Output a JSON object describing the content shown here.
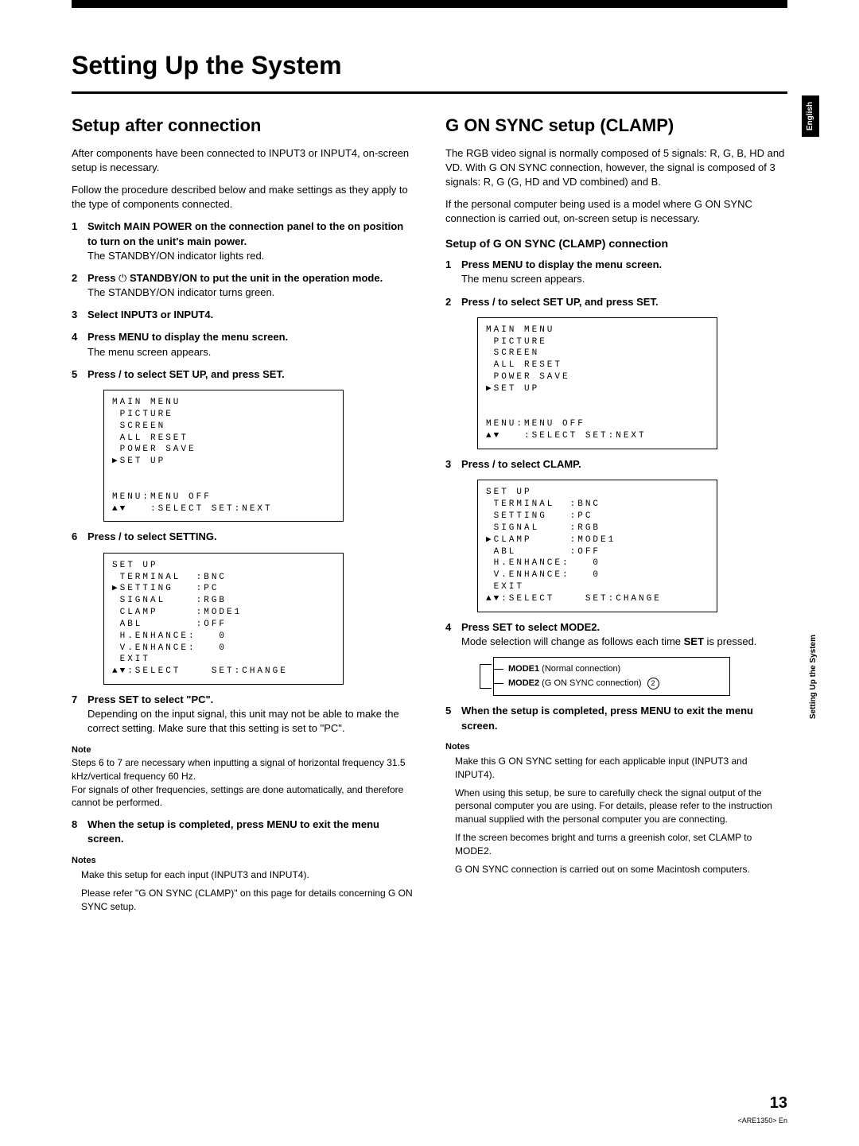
{
  "page_title": "Setting Up the System",
  "side_tab_lang": "English",
  "side_tab_section": "Setting Up the System",
  "page_number": "13",
  "doc_code": "<ARE1350> En",
  "left": {
    "heading": "Setup after connection",
    "intro1": "After components have been connected to INPUT3 or INPUT4, on-screen setup is necessary.",
    "intro2": "Follow the procedure described below and make settings as they apply to the type of components connected.",
    "steps": {
      "s1_bold": "Switch MAIN POWER on the connection panel to the on position to turn on the unit's main power.",
      "s1_body": "The STANDBY/ON indicator lights red.",
      "s2_bold_a": "Press ",
      "s2_bold_b": " STANDBY/ON to put the unit in the operation mode.",
      "s2_body": "The STANDBY/ON indicator turns green.",
      "s3_bold": "Select INPUT3 or INPUT4.",
      "s4_bold": "Press MENU to display the menu screen.",
      "s4_body": "The menu screen appears.",
      "s5_bold": "Press     /     to select SET UP, and press SET.",
      "s6_bold": "Press     /     to select SETTING.",
      "s7_bold": "Press SET to select \"PC\".",
      "s7_body": "Depending on the input signal, this unit may not be able to make the correct setting. Make sure that this setting is set to \"PC\".",
      "s8_bold": "When the setup is completed, press MENU to exit the menu screen."
    },
    "menu_main": "MAIN MENU\n PICTURE\n SCREEN\n ALL RESET\n POWER SAVE\n▶SET UP\n\n\nMENU:MENU OFF\n▲▼   :SELECT SET:NEXT",
    "menu_setup": "SET UP\n TERMINAL  :BNC\n▶SETTING   :PC\n SIGNAL    :RGB\n CLAMP     :MODE1\n ABL       :OFF\n H.ENHANCE:   0\n V.ENHANCE:   0\n EXIT\n▲▼:SELECT    SET:CHANGE",
    "note_label": "Note",
    "note_text1": "Steps 6 to 7 are necessary when inputting a signal of horizontal frequency 31.5 kHz/vertical frequency 60 Hz.",
    "note_text2": "For signals of other frequencies, settings are done automatically, and therefore cannot be performed.",
    "notes_label": "Notes",
    "notes": [
      "Make this setup for each input (INPUT3 and INPUT4).",
      "Please refer \"G ON SYNC (CLAMP)\" on this page for details concerning G ON SYNC  setup."
    ]
  },
  "right": {
    "heading": "G ON SYNC setup (CLAMP)",
    "intro1": "The RGB video signal is normally composed of 5 signals: R, G, B, HD and VD. With G ON SYNC connection, however, the signal is composed of 3 signals: R, G (G, HD and VD combined) and B.",
    "intro2": "If the personal computer being used is a model where G ON SYNC connection is carried out, on-screen setup is necessary.",
    "sub": "Setup of G ON SYNC (CLAMP) connection",
    "steps": {
      "s1_bold": "Press MENU to display the menu screen.",
      "s1_body": "The menu screen appears.",
      "s2_bold": "Press     /     to select SET UP, and press SET.",
      "s3_bold": "Press     /     to select CLAMP.",
      "s4_bold": "Press SET to select MODE2.",
      "s4_body_a": "Mode selection will change as follows each time ",
      "s4_body_b": "SET",
      "s4_body_c": " is pressed.",
      "s5_bold": "When the setup is completed, press MENU to exit the menu screen."
    },
    "menu_main": "MAIN MENU\n PICTURE\n SCREEN\n ALL RESET\n POWER SAVE\n▶SET UP\n\n\nMENU:MENU OFF\n▲▼   :SELECT SET:NEXT",
    "menu_setup": "SET UP\n TERMINAL  :BNC\n SETTING   :PC\n SIGNAL    :RGB\n▶CLAMP     :MODE1\n ABL       :OFF\n H.ENHANCE:   0\n V.ENHANCE:   0\n EXIT\n▲▼:SELECT    SET:CHANGE",
    "mode1_label": "MODE1",
    "mode1_desc": " (Normal connection)",
    "mode2_label": "MODE2",
    "mode2_desc": " (G ON SYNC connection) ",
    "mode2_circ": "2",
    "notes_label": "Notes",
    "notes": [
      "Make this G ON SYNC setting for each applicable input (INPUT3 and INPUT4).",
      "When using this setup, be sure to carefully check the signal output of the personal computer you are using. For details, please refer to the instruction manual supplied with the personal computer you are connecting.",
      "If the screen becomes bright and turns a greenish color, set CLAMP to MODE2.",
      "G ON SYNC connection is carried out on some Macintosh computers."
    ]
  }
}
